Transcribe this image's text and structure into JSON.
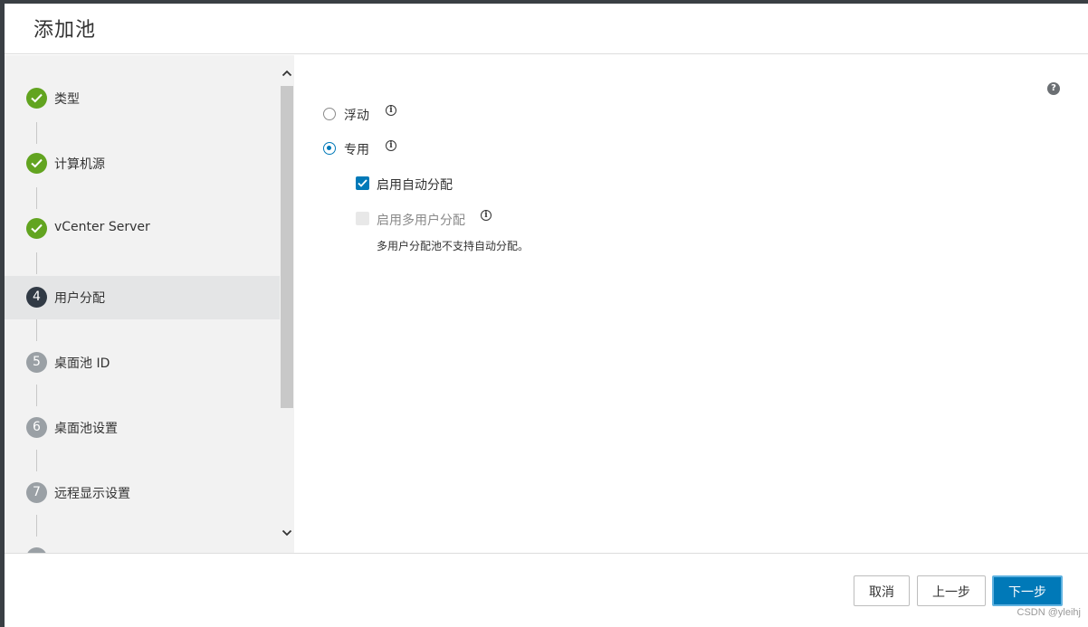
{
  "dialog": {
    "title": "添加池"
  },
  "steps": [
    {
      "number": "1",
      "label": "类型",
      "state": "done"
    },
    {
      "number": "2",
      "label": "计算机源",
      "state": "done"
    },
    {
      "number": "3",
      "label": "vCenter Server",
      "state": "done"
    },
    {
      "number": "4",
      "label": "用户分配",
      "state": "current"
    },
    {
      "number": "5",
      "label": "桌面池 ID",
      "state": "pending"
    },
    {
      "number": "6",
      "label": "桌面池设置",
      "state": "pending"
    },
    {
      "number": "7",
      "label": "远程显示设置",
      "state": "pending"
    }
  ],
  "content": {
    "help_icon": "?",
    "options": [
      {
        "label": "浮动",
        "selected": false
      },
      {
        "label": "专用",
        "selected": true
      }
    ],
    "auto_assign": {
      "label": "启用自动分配",
      "checked": true
    },
    "multi_user": {
      "label": "启用多用户分配",
      "checked": false,
      "disabled": true
    },
    "multi_user_note": "多用户分配池不支持自动分配。"
  },
  "footer": {
    "cancel": "取消",
    "back": "上一步",
    "next": "下一步"
  },
  "watermark": "CSDN @yleihj",
  "colors": {
    "accent": "#0079b8",
    "done": "#62a420",
    "current": "#313a45",
    "pending": "#9aa0a5"
  }
}
